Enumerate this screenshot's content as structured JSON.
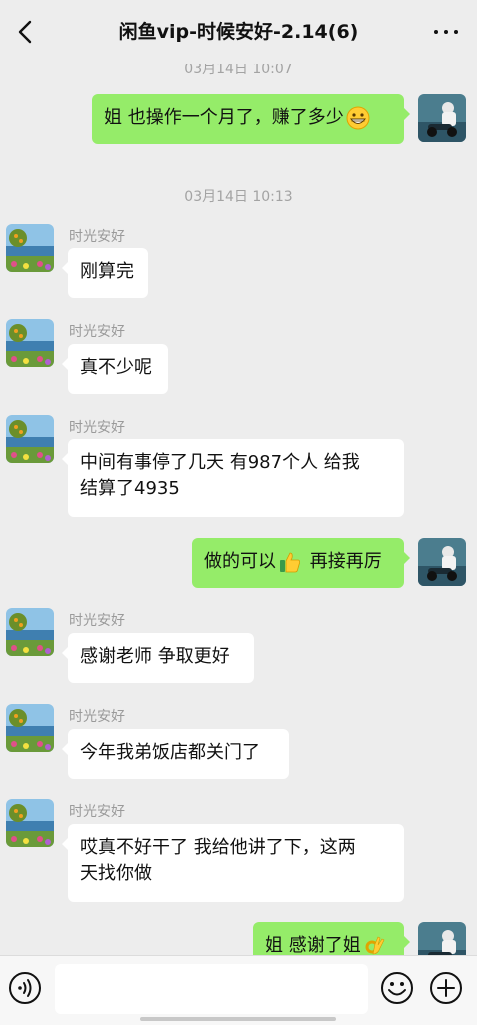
{
  "header": {
    "title": "闲鱼vip-时候安好-2.14(6)"
  },
  "timestamps": {
    "cut_off": "03月14日 10:07",
    "main": "03月14日 10:13"
  },
  "messages": [
    {
      "side": "out",
      "text": "姐 也操作一个月了，赚了多少",
      "emoji": "grinning-face-emoji"
    },
    {
      "side": "in",
      "sender": "时光安好",
      "text": "刚算完"
    },
    {
      "side": "in",
      "sender": "时光安好",
      "text": "真不少呢"
    },
    {
      "side": "in",
      "sender": "时光安好",
      "line1": "中间有事停了几天 有987个人  给我",
      "line2": "结算了4935"
    },
    {
      "side": "out",
      "text_before": "做的可以",
      "emoji": "thumbs-up-emoji",
      "text_after": " 再接再厉"
    },
    {
      "side": "in",
      "sender": "时光安好",
      "text": "感谢老师 争取更好"
    },
    {
      "side": "in",
      "sender": "时光安好",
      "text": "今年我弟饭店都关门了"
    },
    {
      "side": "in",
      "sender": "时光安好",
      "line1": "哎真不好干了  我给他讲了下，这两",
      "line2": "天找你做"
    },
    {
      "side": "out",
      "text": "姐 感谢了姐",
      "emoji": "ok-hand-emoji"
    }
  ],
  "input": {
    "placeholder": "",
    "value": ""
  },
  "icons": {
    "back": "chevron-left-icon",
    "more": "more-dots-icon",
    "voice": "voice-icon",
    "emoji": "smiley-icon",
    "plus": "plus-icon"
  },
  "colors": {
    "outgoing_bubble": "#95ec69",
    "incoming_bubble": "#ffffff",
    "background": "#ededed"
  }
}
